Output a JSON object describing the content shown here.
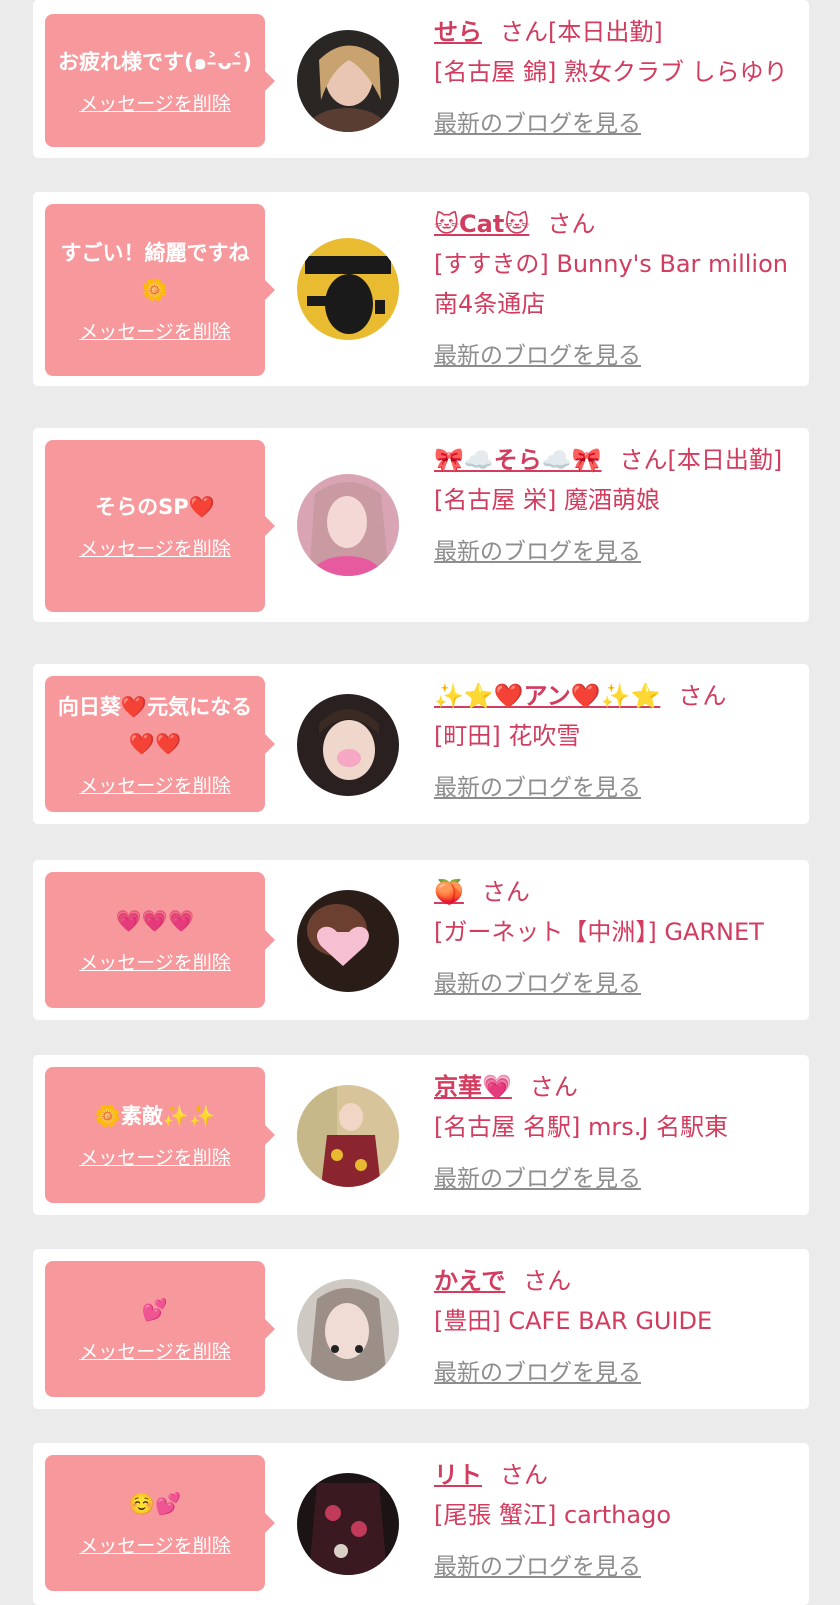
{
  "cards": [
    {
      "message": "お疲れ様です(๑˃̵ᴗ˂̵)",
      "delete_label": "メッセージを削除",
      "name": "せら",
      "san_status": "さん[本日出勤]",
      "shop": "[名古屋 錦] 熟女クラブ しらゆり",
      "blog_label": "最新のブログを見る"
    },
    {
      "message": "すごい！綺麗ですね🌼",
      "delete_label": "メッセージを削除",
      "name": "🐱Cat🐱",
      "san_status": "さん",
      "shop": "[すすきの] Bunny's Bar million 南4条通店",
      "blog_label": "最新のブログを見る"
    },
    {
      "message": "そらのSP❤️",
      "delete_label": "メッセージを削除",
      "name": "🎀☁️そら☁️🎀",
      "san_status": "さん[本日出勤]",
      "shop": "[名古屋 栄] 魔酒萌娘",
      "blog_label": "最新のブログを見る"
    },
    {
      "message": "向日葵❤️元気になる❤️❤️",
      "delete_label": "メッセージを削除",
      "name": "✨⭐❤️アン❤️✨⭐",
      "san_status": "さん",
      "shop": "[町田] 花吹雪",
      "blog_label": "最新のブログを見る"
    },
    {
      "message": "💗💗💗",
      "delete_label": "メッセージを削除",
      "name": "🍑",
      "san_status": "さん",
      "shop": "[ガーネット【中洲】] GARNET",
      "blog_label": "最新のブログを見る"
    },
    {
      "message": "🌼素敵✨✨",
      "delete_label": "メッセージを削除",
      "name": "京華💗",
      "san_status": "さん",
      "shop": "[名古屋 名駅] mrs.J 名駅東",
      "blog_label": "最新のブログを見る"
    },
    {
      "message": "💕",
      "delete_label": "メッセージを削除",
      "name": "かえで",
      "san_status": "さん",
      "shop": "[豊田] CAFE BAR GUIDE",
      "blog_label": "最新のブログを見る"
    },
    {
      "message": "☺️💕",
      "delete_label": "メッセージを削除",
      "name": "リト",
      "san_status": "さん",
      "shop": "[尾張 蟹江] carthago",
      "blog_label": "最新のブログを見る"
    }
  ],
  "colors": {
    "page_bg": "#ebebeb",
    "card_bg": "#ffffff",
    "bubble_bg": "#f7999c",
    "accent_text": "#d23c5e",
    "link_gray": "#8d8d8d"
  },
  "icons": [
    "avatar-photo"
  ]
}
